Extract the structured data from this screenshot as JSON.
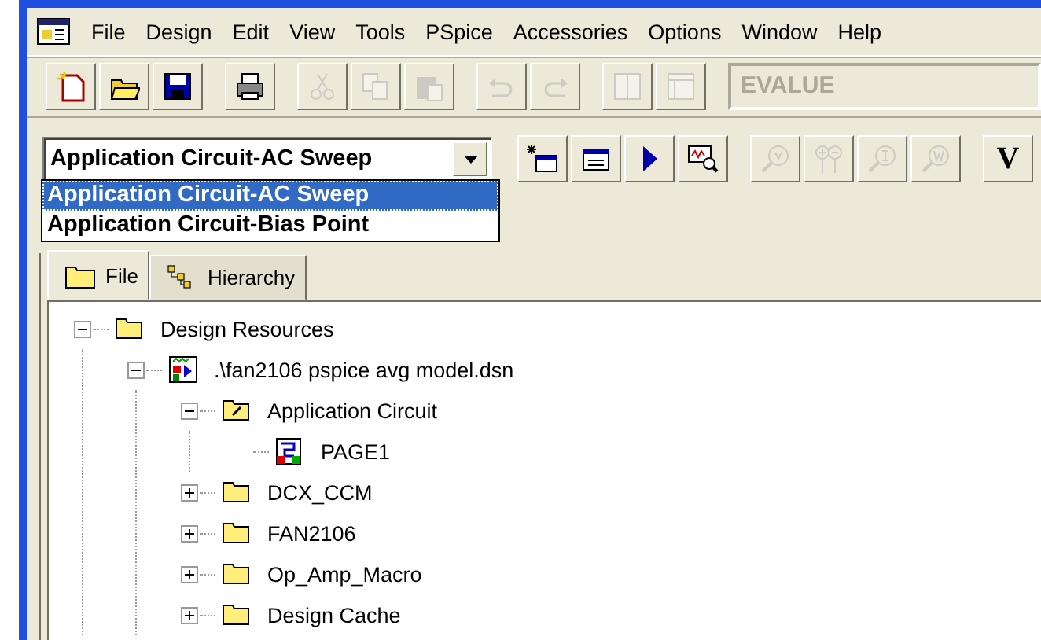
{
  "menu_bar": {
    "items": [
      "File",
      "Design",
      "Edit",
      "View",
      "Tools",
      "PSpice",
      "Accessories",
      "Options",
      "Window",
      "Help"
    ]
  },
  "toolbar": {
    "button_groups": [
      [
        {
          "kind": "new",
          "disabled": false
        },
        {
          "kind": "open",
          "disabled": false
        },
        {
          "kind": "save",
          "disabled": false
        }
      ],
      [
        {
          "kind": "print",
          "disabled": false
        }
      ],
      [
        {
          "kind": "cut",
          "disabled": true
        },
        {
          "kind": "copy",
          "disabled": true
        },
        {
          "kind": "paste",
          "disabled": true
        }
      ],
      [
        {
          "kind": "undo",
          "disabled": true
        },
        {
          "kind": "redo",
          "disabled": true
        }
      ],
      [
        {
          "kind": "columns",
          "disabled": true
        },
        {
          "kind": "window",
          "disabled": true
        }
      ]
    ],
    "part_field": {
      "value": "EVALUE",
      "disabled": true
    }
  },
  "simulation_toolbar": {
    "profile_combo": {
      "value": "Application Circuit-AC Sweep",
      "expanded": true,
      "options": [
        {
          "label": "Application Circuit-AC Sweep",
          "selected": true
        },
        {
          "label": "Application Circuit-Bias Point",
          "selected": false
        }
      ]
    },
    "button_groups": [
      [
        {
          "kind": "new-profile",
          "disabled": false
        },
        {
          "kind": "edit-profile",
          "disabled": false
        },
        {
          "kind": "run",
          "disabled": false
        },
        {
          "kind": "probe",
          "disabled": false
        }
      ],
      [
        {
          "kind": "voltage-marker",
          "disabled": true
        },
        {
          "kind": "diff-marker",
          "disabled": true
        },
        {
          "kind": "current-marker",
          "disabled": true
        },
        {
          "kind": "power-marker",
          "disabled": true
        }
      ],
      [
        {
          "kind": "text",
          "label": "V",
          "disabled": false
        }
      ]
    ]
  },
  "project_tabs": [
    {
      "label": "File",
      "kind": "folder",
      "selected": true
    },
    {
      "label": "Hierarchy",
      "kind": "hierarchy",
      "selected": false
    }
  ],
  "tree": [
    {
      "label": "Design Resources",
      "kind": "folder",
      "expanded": true,
      "children": [
        {
          "label": ".\\fan2106 pspice avg model.dsn",
          "kind": "design",
          "expanded": true,
          "children": [
            {
              "label": "Application Circuit",
              "kind": "schematic-folder",
              "expanded": true,
              "children": [
                {
                  "label": "PAGE1",
                  "kind": "page"
                }
              ]
            },
            {
              "label": "DCX_CCM",
              "kind": "folder",
              "expanded": false
            },
            {
              "label": "FAN2106",
              "kind": "folder",
              "expanded": false
            },
            {
              "label": "Op_Amp_Macro",
              "kind": "folder",
              "expanded": false
            },
            {
              "label": "Design Cache",
              "kind": "folder",
              "expanded": false
            }
          ]
        }
      ]
    }
  ]
}
